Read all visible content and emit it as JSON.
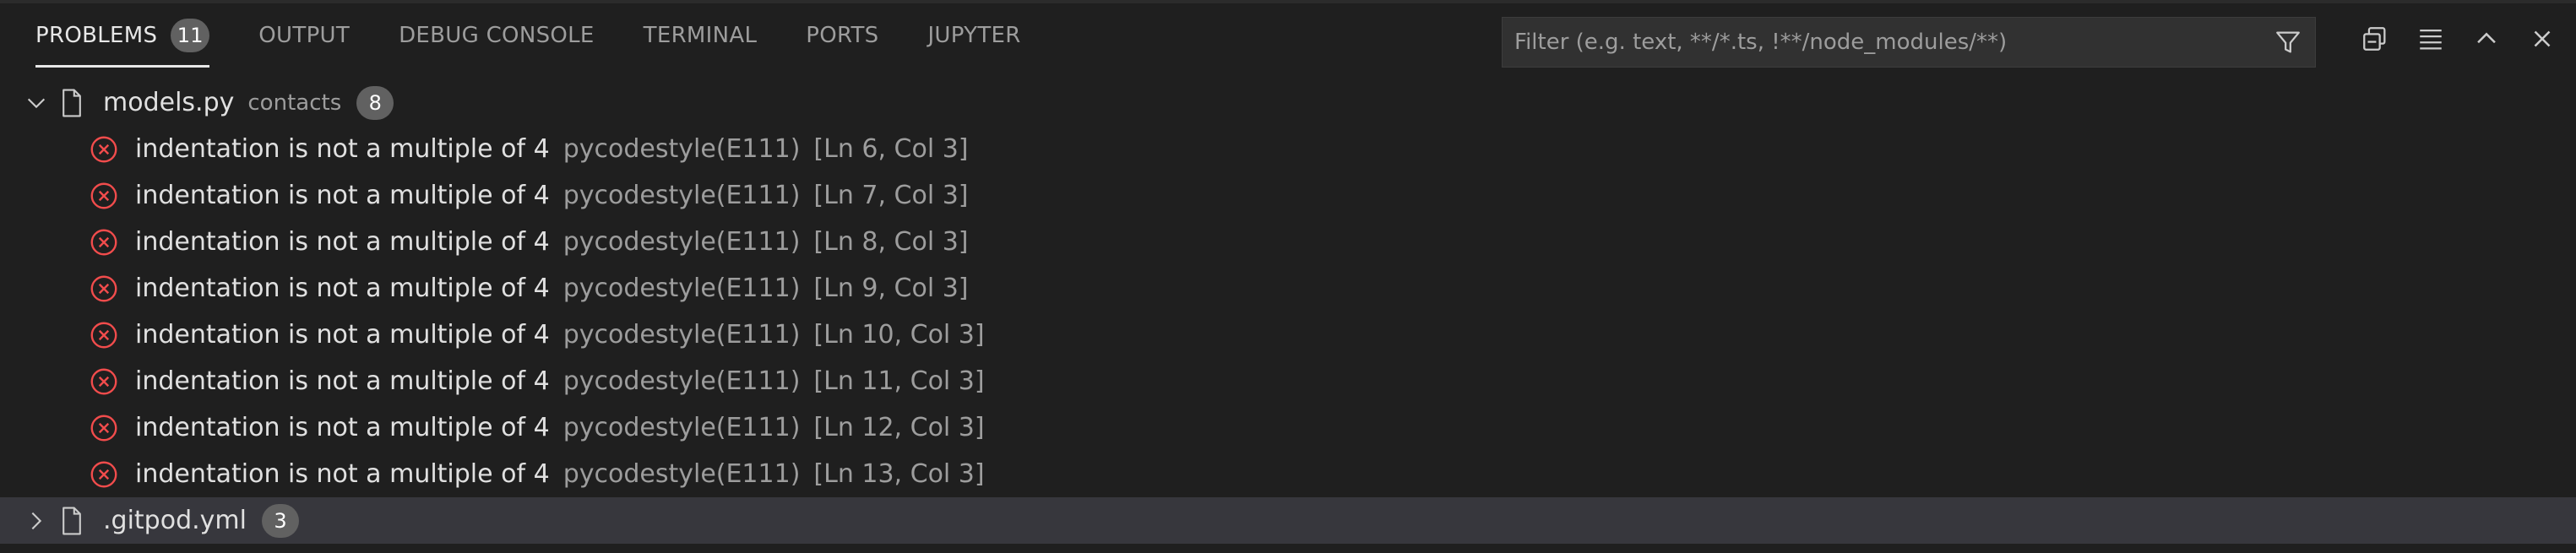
{
  "tabs": [
    {
      "label": "PROBLEMS",
      "badge": "11"
    },
    {
      "label": "OUTPUT"
    },
    {
      "label": "DEBUG CONSOLE"
    },
    {
      "label": "TERMINAL"
    },
    {
      "label": "PORTS"
    },
    {
      "label": "JUPYTER"
    }
  ],
  "filter": {
    "placeholder": "Filter (e.g. text, **/*.ts, !**/node_modules/**)",
    "value": ""
  },
  "actions": [
    "filter-icon",
    "collapse-all-icon",
    "view-as-list-icon",
    "maximize-panel-icon",
    "close-panel-icon"
  ],
  "files": [
    {
      "name": "models.py",
      "dir": "contacts",
      "count": "8",
      "expanded": true,
      "problems": [
        {
          "message": "indentation is not a multiple of 4",
          "source": "pycodestyle(E111)",
          "location": "[Ln 6, Col 3]"
        },
        {
          "message": "indentation is not a multiple of 4",
          "source": "pycodestyle(E111)",
          "location": "[Ln 7, Col 3]"
        },
        {
          "message": "indentation is not a multiple of 4",
          "source": "pycodestyle(E111)",
          "location": "[Ln 8, Col 3]"
        },
        {
          "message": "indentation is not a multiple of 4",
          "source": "pycodestyle(E111)",
          "location": "[Ln 9, Col 3]"
        },
        {
          "message": "indentation is not a multiple of 4",
          "source": "pycodestyle(E111)",
          "location": "[Ln 10, Col 3]"
        },
        {
          "message": "indentation is not a multiple of 4",
          "source": "pycodestyle(E111)",
          "location": "[Ln 11, Col 3]"
        },
        {
          "message": "indentation is not a multiple of 4",
          "source": "pycodestyle(E111)",
          "location": "[Ln 12, Col 3]"
        },
        {
          "message": "indentation is not a multiple of 4",
          "source": "pycodestyle(E111)",
          "location": "[Ln 13, Col 3]"
        }
      ]
    },
    {
      "name": ".gitpod.yml",
      "count": "3",
      "expanded": false
    }
  ],
  "colors": {
    "error": "#f14c4c",
    "background": "#1f1f1f",
    "selected_row": "#37373d"
  }
}
